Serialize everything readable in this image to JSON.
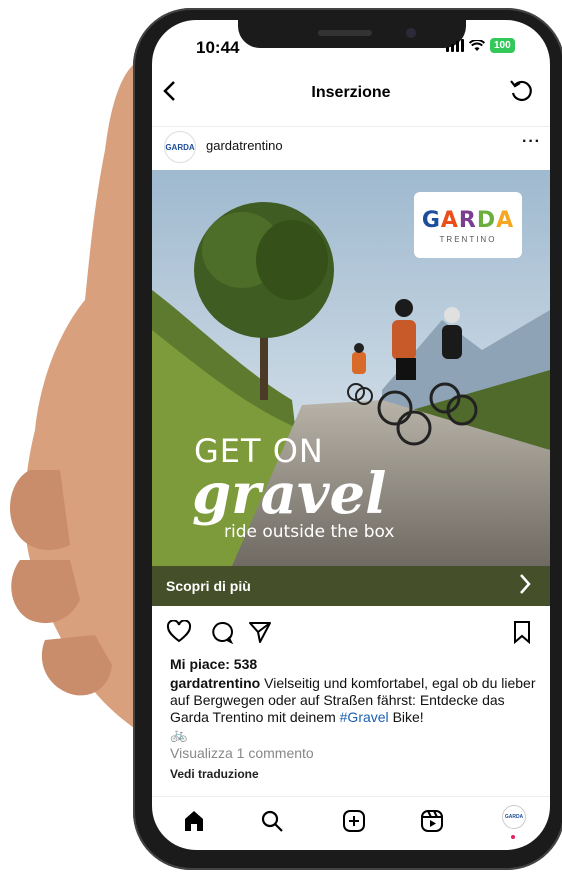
{
  "status": {
    "time": "10:44",
    "battery": "100"
  },
  "header": {
    "title": "Inserzione"
  },
  "post": {
    "username": "gardatrentino",
    "avatar_text": "GARDA",
    "image": {
      "logo_main": "GARDA",
      "logo_sub": "TRENTINO",
      "headline_1": "GET ON",
      "headline_2": "gravel",
      "tagline": "ride outside the box"
    },
    "cta_label": "Scopri di più",
    "likes": "Mi piace: 538",
    "caption_user": "gardatrentino",
    "caption_text": "Vielseitig und komfortabel, egal ob du lieber auf Bergwegen oder auf Straßen fährst: Entdecke das Garda Trentino mit deinem",
    "caption_tag": "#Gravel",
    "caption_tail": "Bike!",
    "caption_emoji": "🚲",
    "comments_link": "Visualizza 1 commento",
    "translate_link": "Vedi traduzione"
  },
  "nav": {
    "profile_avatar_text": "GARDA"
  },
  "colors": {
    "cta_bg": "#45502a",
    "hashtag": "#1a5fb4",
    "logo_g": "#1d4e9a",
    "logo_a": "#e94e1b",
    "logo_r": "#7a3d8f",
    "logo_d": "#6cae3e",
    "logo_a2": "#f5a623"
  }
}
